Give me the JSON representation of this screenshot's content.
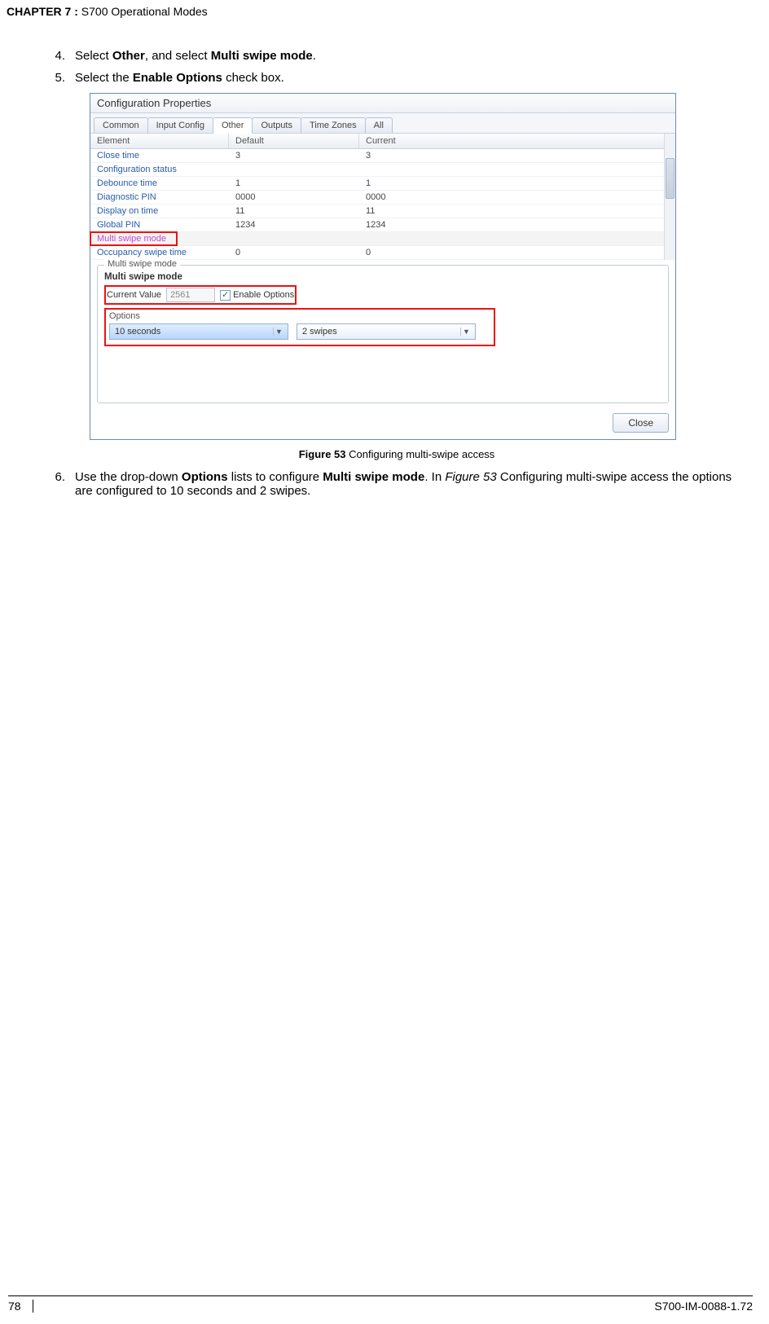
{
  "header": {
    "chapter": "CHAPTER  7 :",
    "title": " S700 Operational Modes"
  },
  "steps": {
    "s4": {
      "num": "4.",
      "pre": "Select ",
      "b1": "Other",
      "mid": ", and select ",
      "b2": "Multi swipe mode",
      "post": "."
    },
    "s5": {
      "num": "5.",
      "pre": "Select the ",
      "b1": "Enable Options",
      "post": " check box."
    },
    "s6": {
      "num": "6.",
      "pre": "Use the drop-down ",
      "b1": "Options",
      "mid1": " lists to configure ",
      "b2": "Multi swipe mode",
      "mid2": ". In ",
      "it": "Figure 53",
      "post": " Configuring multi-swipe access the options are configured to 10 seconds and 2 swipes."
    }
  },
  "figcap": {
    "bold": "Figure 53",
    "rest": " Configuring multi-swipe access"
  },
  "window": {
    "title": "Configuration Properties",
    "tabs": [
      "Common",
      "Input Config",
      "Other",
      "Outputs",
      "Time Zones",
      "All"
    ],
    "cols": {
      "el": "Element",
      "def": "Default",
      "cur": "Current"
    },
    "rows": [
      {
        "el": "Close time",
        "def": "3",
        "cur": "3"
      },
      {
        "el": "Configuration status",
        "def": "",
        "cur": ""
      },
      {
        "el": "Debounce time",
        "def": "1",
        "cur": "1"
      },
      {
        "el": "Diagnostic PIN",
        "def": "0000",
        "cur": "0000"
      },
      {
        "el": "Display on time",
        "def": "11",
        "cur": "11"
      },
      {
        "el": "Global PIN",
        "def": "1234",
        "cur": "1234"
      },
      {
        "el": "Multi swipe mode",
        "def": "",
        "cur": ""
      },
      {
        "el": "Occupancy swipe time",
        "def": "0",
        "cur": "0"
      }
    ],
    "panel": {
      "legend": "Multi swipe mode",
      "title": "Multi swipe mode",
      "cvlabel": "Current Value",
      "cvvalue": "2561",
      "enable": "Enable Options",
      "optlegend": "Options",
      "opt1": "10 seconds",
      "opt2": "2 swipes"
    },
    "close": "Close"
  },
  "footer": {
    "page": "78",
    "doc": "S700-IM-0088-1.72"
  }
}
